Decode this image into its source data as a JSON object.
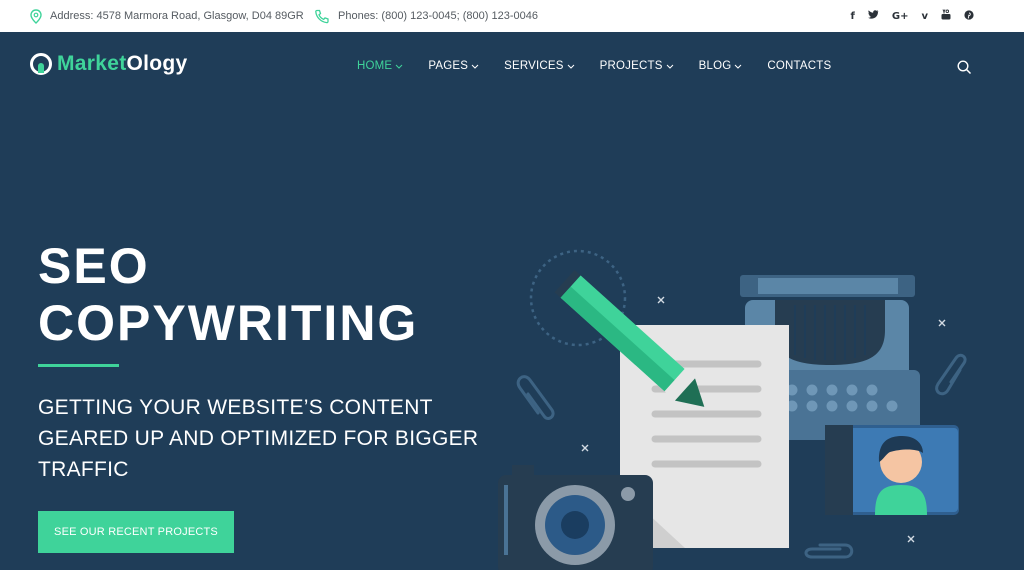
{
  "topbar": {
    "address": "Address: 4578 Marmora Road, Glasgow, D04 89GR",
    "phones": "Phones: (800) 123-0045; (800) 123-0046",
    "social": [
      "f",
      "t",
      "G+",
      "v",
      "yt",
      "p"
    ]
  },
  "header": {
    "logo_part1": "Market",
    "logo_part2": "Ology",
    "nav": [
      {
        "label": "HOME"
      },
      {
        "label": "PAGES"
      },
      {
        "label": "SERVICES"
      },
      {
        "label": "PROJECTS"
      },
      {
        "label": "BLOG"
      },
      {
        "label": "CONTACTS"
      }
    ]
  },
  "hero": {
    "title_line1": "SEO",
    "title_line2": "COPYWRITING",
    "subtitle": "GETTING YOUR WEBSITE’S CONTENT GEARED UP AND OPTIMIZED FOR BIGGER TRAFFIC",
    "cta_label": "SEE OUR RECENT PROJECTS"
  },
  "colors": {
    "accent": "#3fd39a",
    "background": "#1f3d58",
    "topbar": "#ffffff"
  },
  "icons": [
    "map-pin-icon",
    "phone-icon",
    "chevron-down-icon",
    "search-icon"
  ]
}
